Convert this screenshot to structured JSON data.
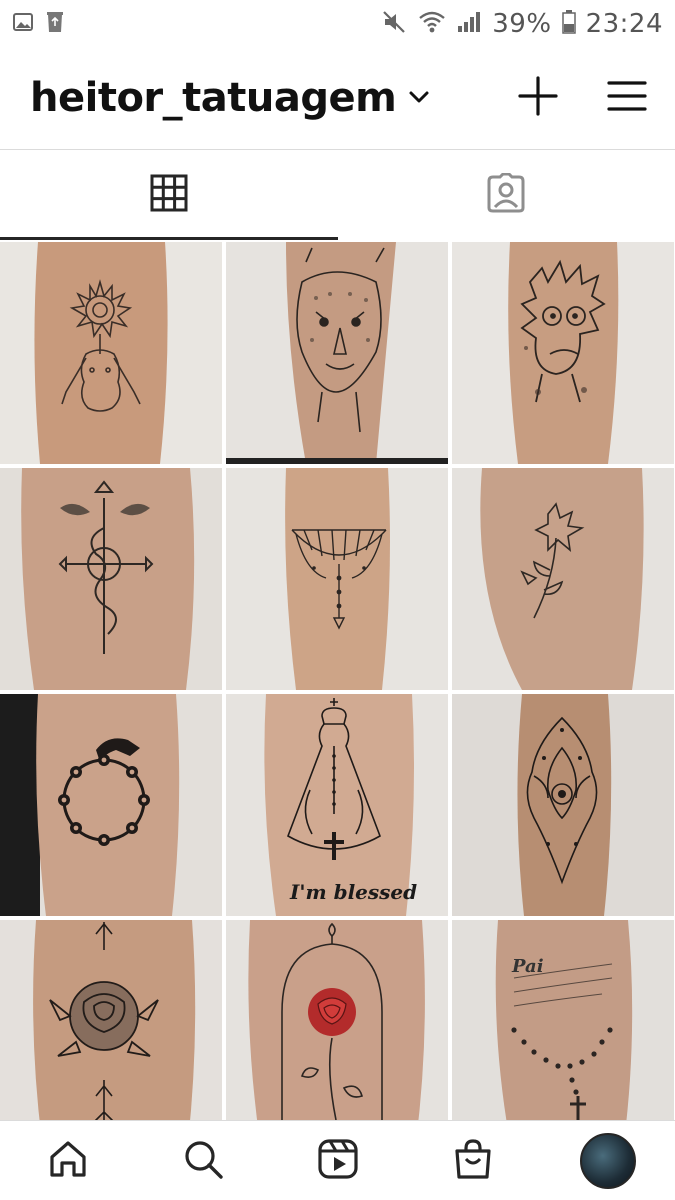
{
  "status_bar": {
    "battery": "39%",
    "time": "23:24"
  },
  "header": {
    "username": "heitor_tatuagem"
  },
  "tabs": [
    {
      "name": "grid-tab",
      "icon": "grid-icon",
      "active": true
    },
    {
      "name": "tagged-tab",
      "icon": "tagged-person-icon",
      "active": false
    }
  ],
  "posts": [
    {
      "motif": "sunflower-woman"
    },
    {
      "motif": "lion"
    },
    {
      "motif": "rick-cartoon"
    },
    {
      "motif": "alchemy-cross"
    },
    {
      "motif": "mandala-chandelier"
    },
    {
      "motif": "lily-flower"
    },
    {
      "motif": "dragon-ring"
    },
    {
      "motif": "our-lady",
      "caption": "I'm blessed"
    },
    {
      "motif": "lotus-mandala"
    },
    {
      "motif": "rose-arrows"
    },
    {
      "motif": "rose-bell-jar"
    },
    {
      "motif": "rosary-script",
      "caption": "Pai"
    }
  ],
  "bottom_nav": [
    {
      "icon": "home-icon"
    },
    {
      "icon": "search-icon"
    },
    {
      "icon": "reels-icon"
    },
    {
      "icon": "shop-icon"
    },
    {
      "icon": "profile-avatar"
    }
  ],
  "colors": {
    "text": "#262626",
    "divider": "#dbdbdb",
    "skin": "#c9a084",
    "background": "#ffffff"
  }
}
